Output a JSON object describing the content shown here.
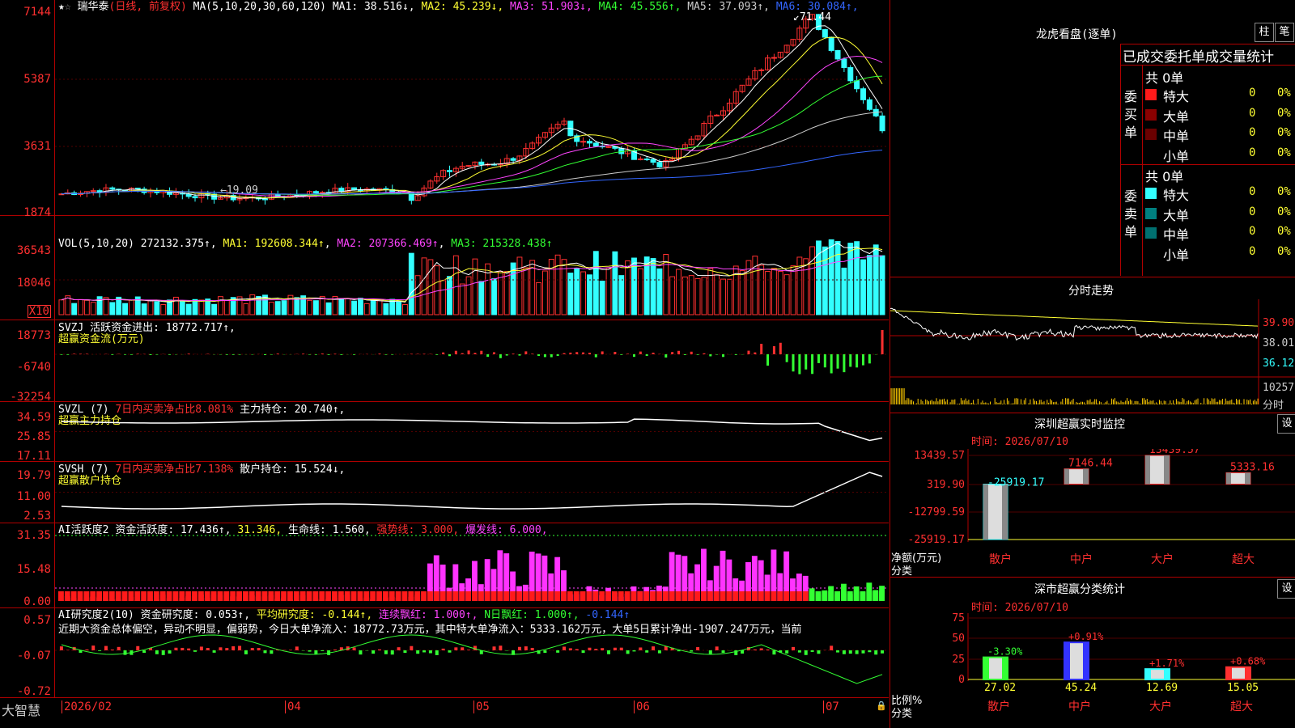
{
  "stock": {
    "star_icon": "star",
    "name": "瑞华泰",
    "mode": "(日线, 前复权)",
    "ma_spec": "MA(5,10,20,30,60,120)",
    "ma": [
      {
        "label": "MA1:",
        "value": "38.516↓",
        "color": "#ffffff"
      },
      {
        "label": "MA2:",
        "value": "45.239↓",
        "color": "#ffff33"
      },
      {
        "label": "MA3:",
        "value": "51.903↓",
        "color": "#ff44ff"
      },
      {
        "label": "MA4:",
        "value": "45.556↑",
        "color": "#33ff33"
      },
      {
        "label": "MA5:",
        "value": "37.093↑",
        "color": "#cccccc"
      },
      {
        "label": "MA6:",
        "value": "30.084↑",
        "color": "#3366ff"
      }
    ],
    "y_labels": [
      "7144",
      "5387",
      "3631",
      "1874"
    ],
    "high_mark": "71.44",
    "low_mark": "19.09"
  },
  "vol": {
    "spec": "VOL(5,10,20)",
    "value": "272132.375↑",
    "ma1": "MA1: 192608.344↑",
    "ma2": "MA2: 207366.469↑",
    "ma3": "MA3: 215328.438↑",
    "y_labels": [
      "36543",
      "18046"
    ],
    "unit": "X10"
  },
  "svzj": {
    "title": "SVZJ  活跃资金进出: 18772.717↑,",
    "subtitle": "超赢资金流(万元)",
    "y_labels": [
      "18773",
      "-6740",
      "-32254"
    ]
  },
  "svzl": {
    "spec": "SVZL (7)",
    "t1": "7日内买卖净占比8.081%",
    "t2": "主力持仓: 20.740↑,",
    "subtitle": "超赢主力持仓",
    "y_labels": [
      "34.59",
      "25.85",
      "17.11"
    ]
  },
  "svsh": {
    "spec": "SVSH (7)",
    "t1": "7日内买卖净占比7.138%",
    "t2": "散户持仓: 15.524↓,",
    "subtitle": "超赢散户持仓",
    "y_labels": [
      "19.79",
      "11.00",
      "2.53"
    ]
  },
  "ai_active": {
    "t0": "AI活跃度2",
    "t1": "资金活跃度: 17.436↑,",
    "t2": "31.346,",
    "t3": "生命线: 1.560,",
    "t4": "强势线: 3.000,",
    "t5": "爆发线: 6.000,",
    "y_labels": [
      "31.35",
      "15.48",
      "0.00"
    ]
  },
  "ai_research": {
    "t0": "AI研究度2(10)",
    "t1": "资金研究度: 0.053↑,",
    "t2": "平均研究度: -0.144↑,",
    "t3": "连续飘红: 1.000↑,",
    "t4": "N日飘红: 1.000↑,",
    "t5": "-0.144↑",
    "commentary": "近期大资金总体偏空，异动不明显，偏弱势，今日大单净流入：18772.73万元，其中特大单净流入：5333.162万元，大单5日累计净出-1907.247万元，当前",
    "y_labels": [
      "0.57",
      "-0.07",
      "-0.72"
    ]
  },
  "xaxis": {
    "brand": "大智慧",
    "labels": [
      "2026/02",
      "04",
      "05",
      "06",
      "07"
    ]
  },
  "right": {
    "longhu_title": "龙虎看盘(逐单)",
    "btn1": "柱",
    "btn2": "笔",
    "stat_header": "已成交委托单成交量统计",
    "buy": {
      "side": "委买单",
      "total": "共 0单",
      "rows": [
        {
          "name": "特大",
          "value": "0",
          "pct": "0%"
        },
        {
          "name": "大单",
          "value": "0",
          "pct": "0%"
        },
        {
          "name": "中单",
          "value": "0",
          "pct": "0%"
        },
        {
          "name": "小单",
          "value": "0",
          "pct": "0%"
        }
      ]
    },
    "sell": {
      "side": "委卖单",
      "total": "共 0单",
      "rows": [
        {
          "name": "特大",
          "value": "0",
          "pct": "0%"
        },
        {
          "name": "大单",
          "value": "0",
          "pct": "0%"
        },
        {
          "name": "中单",
          "value": "0",
          "pct": "0%"
        },
        {
          "name": "小单",
          "value": "0",
          "pct": "0%"
        }
      ]
    },
    "fenshi_title": "分时走势",
    "fenshi_y": [
      "39.90",
      "38.01",
      "36.12",
      "10257"
    ],
    "fenshi_unit": "分时",
    "sz_monitor": {
      "title": "深圳超赢实时监控",
      "btn": "设",
      "time": "时间: 2026/07/10",
      "y_labels": [
        "13439.57",
        "319.90",
        "-12799.59",
        "-25919.17"
      ],
      "unit": "净额(万元)",
      "cat_label": "分类",
      "bars": [
        {
          "name": "散户",
          "value": -25919.17,
          "label": "-25919.17"
        },
        {
          "name": "中户",
          "value": 7146.44,
          "label": "7146.44"
        },
        {
          "name": "大户",
          "value": 13439.57,
          "label": "13439.57"
        },
        {
          "name": "超大",
          "value": 5333.16,
          "label": "5333.16"
        }
      ]
    },
    "sz_category": {
      "title": "深市超赢分类统计",
      "btn": "设",
      "time": "时间: 2026/07/10",
      "y_labels": [
        "75",
        "50",
        "25",
        "0"
      ],
      "unit": "比例%",
      "cat_label": "分类",
      "bars": [
        {
          "name": "散户",
          "value": 27.02,
          "label": "27.02",
          "change": "-3.30%"
        },
        {
          "name": "中户",
          "value": 45.24,
          "label": "45.24",
          "change": "+0.91%"
        },
        {
          "name": "大户",
          "value": 12.69,
          "label": "12.69",
          "change": "+1.71%"
        },
        {
          "name": "超大",
          "value": 15.05,
          "label": "15.05",
          "change": "+0.68%"
        }
      ]
    }
  }
}
